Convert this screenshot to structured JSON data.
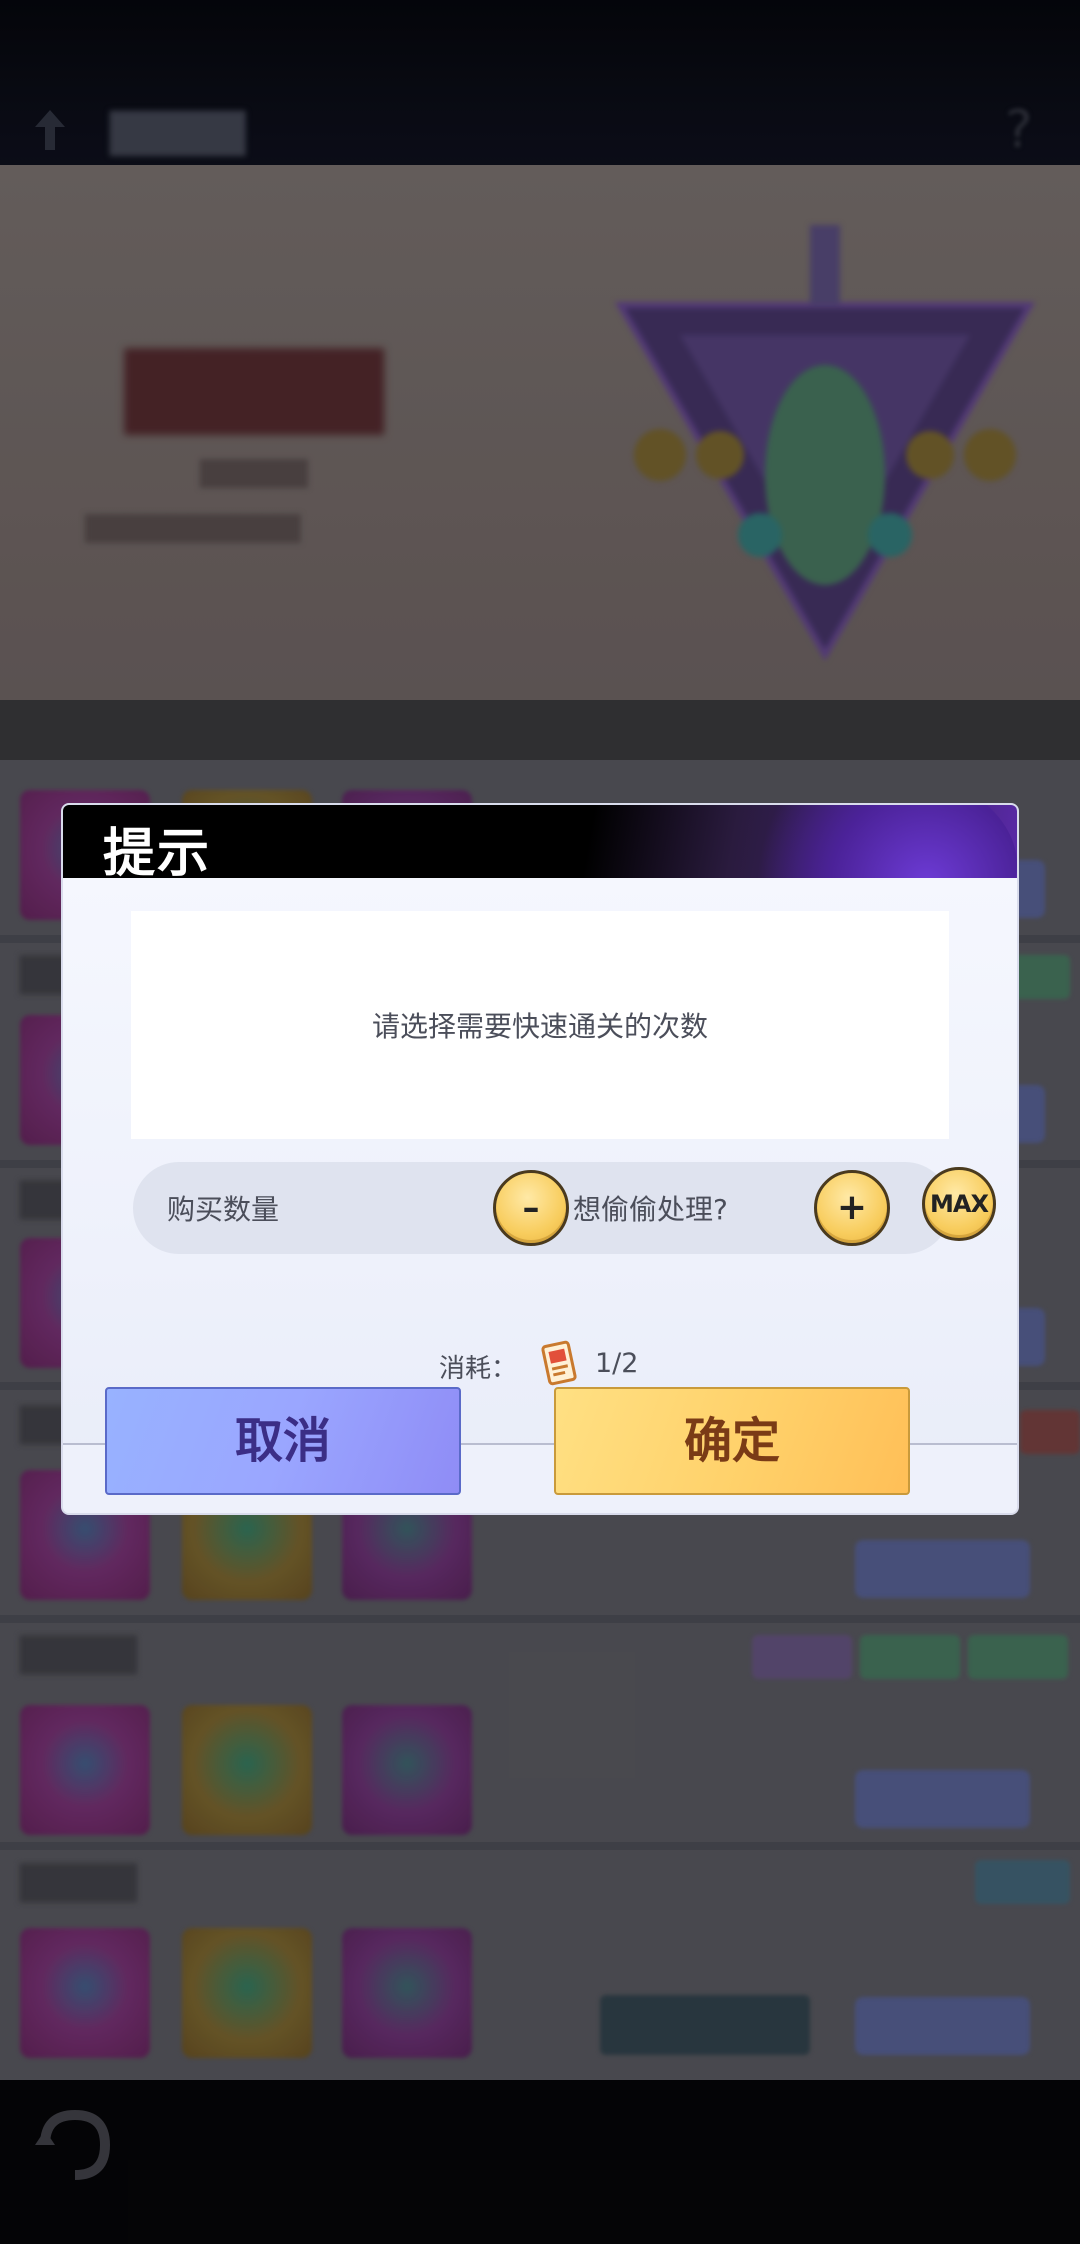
{
  "dialog": {
    "title": "提示",
    "message": "请选择需要快速通关的次数",
    "quantity_label": "购买数量",
    "quantity_value": "想偷偷处理?",
    "minus_symbol": "–",
    "plus_symbol": "+",
    "max_label": "MAX",
    "cost_label": "消耗：",
    "cost_value": "1/2",
    "cost_icon": "ticket-card-icon",
    "cancel_label": "取消",
    "confirm_label": "确定"
  },
  "colors": {
    "cancel_button": "#9aa6ff",
    "confirm_button": "#ffd16a",
    "round_button": "#f8cd5e",
    "header_bg": "#000000"
  }
}
